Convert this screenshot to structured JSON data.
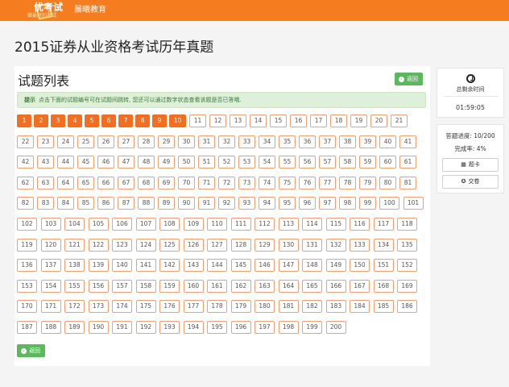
{
  "header": {
    "logo_text": "优考试",
    "logo_sub": "做最好的考试",
    "brand": "晨曦教育"
  },
  "page_title": "2015证券从业资格考试历年真题",
  "list": {
    "title": "试题列表",
    "back_label": "返回",
    "tip_label": "提示",
    "tip_text": "点击下面的试题编号可在试题间跳转, 您还可以通过数字状态查看该题是否已答哦.",
    "total": 200,
    "answered": [
      1,
      2,
      3,
      4,
      5,
      6,
      7,
      8,
      9,
      10
    ]
  },
  "sidebar": {
    "time_label": "总剩余时间",
    "time_value": "01:59:05",
    "progress": "答题进度: 10/200",
    "rate": "完成率: 4%",
    "card_label": "题卡",
    "submit_label": "交卷"
  },
  "colors": {
    "brand": "#f57c1f",
    "answered": "#f26f21",
    "success": "#5cb85c"
  }
}
